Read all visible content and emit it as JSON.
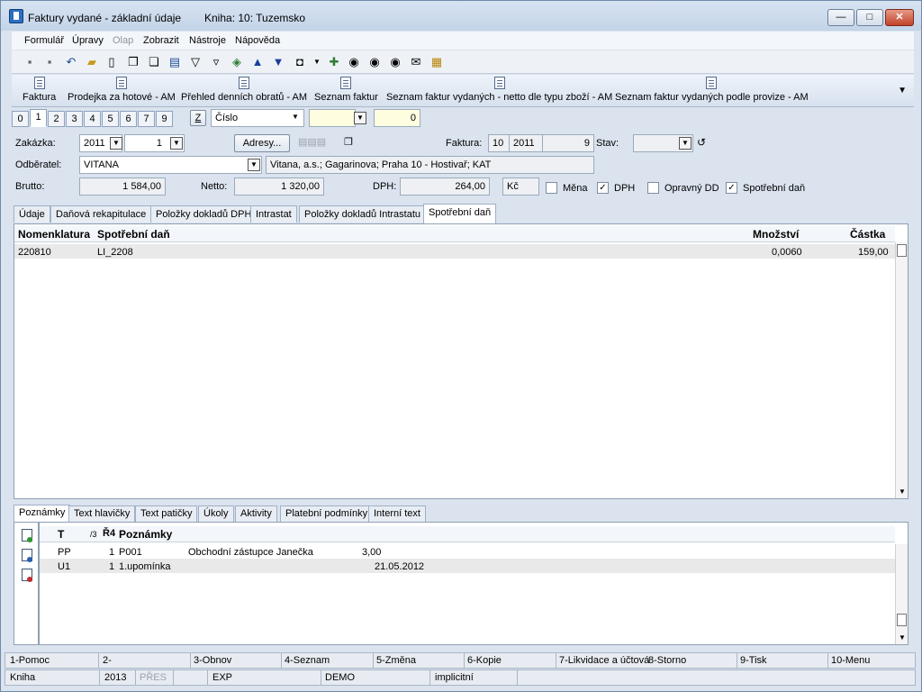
{
  "window": {
    "title": "Faktury vydané - základní údaje",
    "book": "Kniha: 10: Tuzemsko",
    "min": "—",
    "max": "□",
    "close": "✕"
  },
  "menu": [
    {
      "label": "Formulář",
      "enabled": true
    },
    {
      "label": "Úpravy",
      "enabled": true
    },
    {
      "label": "Olap",
      "enabled": false
    },
    {
      "label": "Zobrazit",
      "enabled": true
    },
    {
      "label": "Nástroje",
      "enabled": true
    },
    {
      "label": "Nápověda",
      "enabled": true
    }
  ],
  "toolbar": [
    "save-icon",
    "save-all-icon",
    "undo-icon",
    "open-folder-icon",
    "new-document-icon",
    "copy-icon",
    "paste-icon",
    "book-icon",
    "filter-icon",
    "filter-list-icon",
    "stack-icon",
    "up-arrow-icon",
    "down-arrow-icon",
    "camera-icon",
    "dropdown-arrow-icon",
    "refresh-icon",
    "binoculars-icon",
    "binoculars-next-icon",
    "binoculars-search-icon",
    "mail-icon",
    "notes-icon"
  ],
  "reports": [
    "Faktura",
    "Prodejka za hotové - AM",
    "Přehled denních obratů - AM",
    "Seznam faktur",
    "Seznam faktur vydaných - netto dle typu zboží - AM",
    "Seznam faktur vydaných podle provize - AM"
  ],
  "pages": [
    "0",
    "1",
    "2",
    "3",
    "4",
    "5",
    "6",
    "7",
    "9"
  ],
  "active_page": "1",
  "sort": {
    "z": "Z",
    "field": "Číslo",
    "value": "0"
  },
  "header": {
    "zakazka_label": "Zakázka:",
    "zakazka_year": "2011",
    "zakazka_num": "1",
    "adresy_button": "Adresy...",
    "faktura_label": "Faktura:",
    "faktura_book": "10",
    "faktura_year": "2011",
    "faktura_num": "9",
    "stav_label": "Stav:",
    "stav_value": "",
    "odberatel_label": "Odběratel:",
    "odberatel_value": "VITANA",
    "odberatel_address": "Vitana, a.s.; Gagarinova; Praha 10 - Hostivař; KAT",
    "brutto_label": "Brutto:",
    "brutto_value": "1 584,00",
    "netto_label": "Netto:",
    "netto_value": "1 320,00",
    "dph_label": "DPH:",
    "dph_value": "264,00",
    "currency": "Kč",
    "mena_label": "Měna",
    "mena_checked": false,
    "dph_check_label": "DPH",
    "dph_checked": true,
    "opravny_label": "Opravný DD",
    "opravny_checked": false,
    "spotrebni_label": "Spotřební daň",
    "spotrebni_checked": true
  },
  "tabs": [
    "Údaje",
    "Daňová rekapitulace",
    "Položky dokladů DPH",
    "Intrastat",
    "Položky dokladů Intrastatu",
    "Spotřební daň"
  ],
  "active_tab": "Spotřební daň",
  "grid": {
    "columns": [
      "Nomenklatura",
      "Spotřební daň",
      "Množství",
      "Částka"
    ],
    "rows": [
      [
        "220810",
        "LI_2208",
        "0,0060",
        "159,00"
      ]
    ]
  },
  "note_tabs": [
    "Poznámky",
    "Text hlavičky",
    "Text patičky",
    "Úkoly",
    "Aktivity",
    "Platební podmínky",
    "Interní text"
  ],
  "active_note_tab": "Poznámky",
  "notes": {
    "columns": [
      "T",
      "/3",
      "Ř4",
      "Poznámky"
    ],
    "rows": [
      [
        "PP",
        "1",
        "P001",
        "Obchodní zástupce Janečka",
        "3,00"
      ],
      [
        "U1",
        "1",
        "1.upomínka",
        "21.05.2012",
        ""
      ]
    ]
  },
  "fkeys": [
    "1-Pomoc",
    "2-",
    "3-Obnov",
    "4-Seznam",
    "5-Změna",
    "6-Kopie",
    "7-Likvidace a účtová",
    "8-Storno",
    "9-Tisk",
    "10-Menu"
  ],
  "status": [
    "Kniha",
    "2013",
    "PŘES",
    "EXP",
    "DEMO",
    "implicitní"
  ]
}
